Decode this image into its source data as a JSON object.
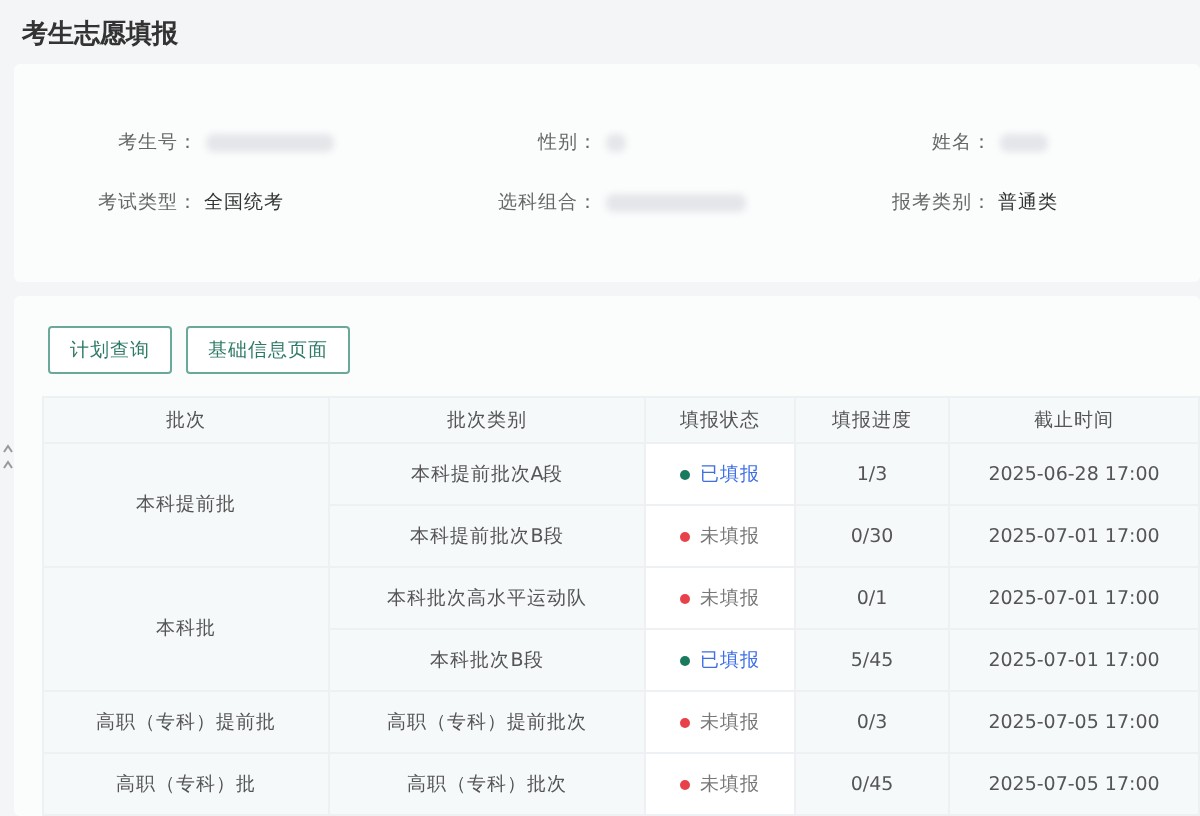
{
  "page_title": "考生志愿填报",
  "info_fields": [
    {
      "label": "考生号：",
      "value_redacted": true
    },
    {
      "label": "性别：",
      "value_redacted": true
    },
    {
      "label": "姓名：",
      "value_redacted": true
    },
    {
      "label": "考试类型：",
      "value": "全国统考"
    },
    {
      "label": "选科组合：",
      "value_redacted": true
    },
    {
      "label": "报考类别：",
      "value": "普通类"
    }
  ],
  "buttons": [
    "计划查询",
    "基础信息页面"
  ],
  "table": {
    "columns": [
      "批次",
      "批次类别",
      "填报状态",
      "填报进度",
      "截止时间"
    ],
    "groups": [
      {
        "batch": "本科提前批",
        "rows": [
          {
            "category": "本科提前批次A段",
            "status": "已填报",
            "filled": true,
            "color": "#1a7a5e",
            "progress": "1/3",
            "deadline": "2025-06-28 17:00"
          },
          {
            "category": "本科提前批次B段",
            "status": "未填报",
            "filled": false,
            "color": "#e8414a",
            "progress": "0/30",
            "deadline": "2025-07-01 17:00"
          }
        ]
      },
      {
        "batch": "本科批",
        "rows": [
          {
            "category": "本科批次高水平运动队",
            "status": "未填报",
            "filled": false,
            "color": "#e8414a",
            "progress": "0/1",
            "deadline": "2025-07-01 17:00"
          },
          {
            "category": "本科批次B段",
            "status": "已填报",
            "filled": true,
            "color": "#1a7a5e",
            "progress": "5/45",
            "deadline": "2025-07-01 17:00"
          }
        ]
      },
      {
        "batch": "高职（专科）提前批",
        "rows": [
          {
            "category": "高职（专科）提前批次",
            "status": "未填报",
            "filled": false,
            "color": "#e8414a",
            "progress": "0/3",
            "deadline": "2025-07-05 17:00"
          }
        ]
      },
      {
        "batch": "高职（专科）批",
        "rows": [
          {
            "category": "高职（专科）批次",
            "status": "未填报",
            "filled": false,
            "color": "#e8414a",
            "progress": "0/45",
            "deadline": "2025-07-05 17:00"
          }
        ]
      }
    ]
  }
}
